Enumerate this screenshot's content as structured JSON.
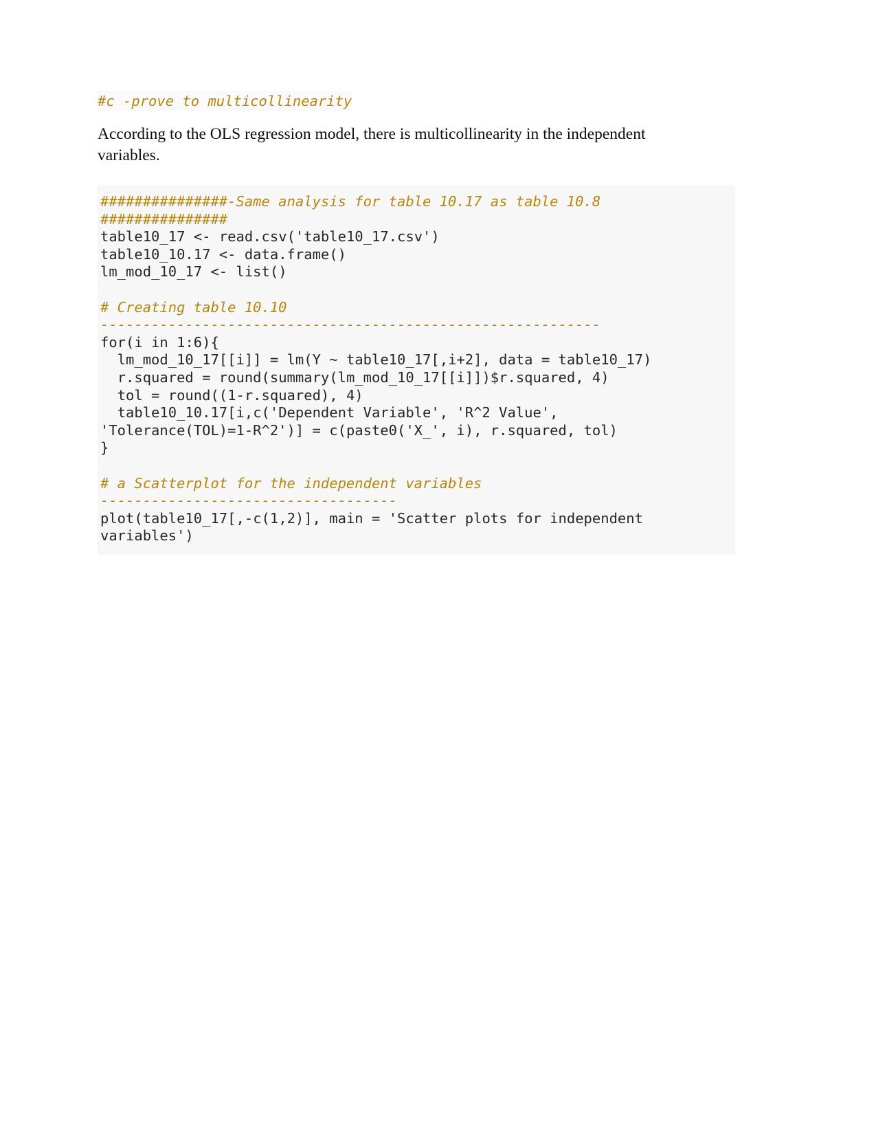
{
  "document": {
    "heading_comment": "#c -prove to multicollinearity",
    "paragraph": "According to the OLS regression model, there is multicollinearity in the independent variables."
  },
  "code_block": {
    "language": "R",
    "background_color": "#f7f7f7",
    "colors": {
      "comment": "#b8860b",
      "function": "#1a4f9c",
      "string": "#4e9a06",
      "number": "#2200cc",
      "operator": "#e08000",
      "argument": "#3b78c3",
      "plain": "#262626"
    },
    "lines": [
      {
        "id": "l1",
        "tokens": [
          {
            "t": "###############-Same analysis for table 10.17 as table 10.8",
            "c": "comment"
          }
        ]
      },
      {
        "id": "l2",
        "tokens": [
          {
            "t": "###############",
            "c": "comment"
          }
        ]
      },
      {
        "id": "l3",
        "tokens": [
          {
            "t": "table10",
            "c": "plain"
          },
          {
            "t": "_17",
            "c": "number"
          },
          {
            "t": " <- ",
            "c": "plain"
          },
          {
            "t": "read.csv",
            "c": "function"
          },
          {
            "t": "(",
            "c": "plain"
          },
          {
            "t": "'table10_17.csv'",
            "c": "string"
          },
          {
            "t": ")",
            "c": "plain"
          }
        ]
      },
      {
        "id": "l4",
        "tokens": [
          {
            "t": "table10",
            "c": "plain"
          },
          {
            "t": "_10.17",
            "c": "number"
          },
          {
            "t": " <- ",
            "c": "plain"
          },
          {
            "t": "data.frame",
            "c": "function"
          },
          {
            "t": "()",
            "c": "plain"
          }
        ]
      },
      {
        "id": "l5",
        "tokens": [
          {
            "t": "lm_mod",
            "c": "plain"
          },
          {
            "t": "_10_17",
            "c": "number"
          },
          {
            "t": " <- ",
            "c": "plain"
          },
          {
            "t": "list",
            "c": "function"
          },
          {
            "t": "()",
            "c": "plain"
          }
        ]
      },
      {
        "id": "l6",
        "tokens": []
      },
      {
        "id": "l7",
        "tokens": [
          {
            "t": "# Creating table 10.10",
            "c": "comment"
          }
        ]
      },
      {
        "id": "l8",
        "tokens": [
          {
            "t": "-----------------------------------------------------------",
            "c": "comment"
          }
        ]
      },
      {
        "id": "l9",
        "tokens": [
          {
            "t": "for",
            "c": "function"
          },
          {
            "t": "(i ",
            "c": "plain"
          },
          {
            "t": "in",
            "c": "function"
          },
          {
            "t": " ",
            "c": "plain"
          },
          {
            "t": "1",
            "c": "number"
          },
          {
            "t": ":",
            "c": "operator"
          },
          {
            "t": "6",
            "c": "number"
          },
          {
            "t": "){",
            "c": "plain"
          }
        ]
      },
      {
        "id": "l10",
        "tokens": [
          {
            "t": "  lm_mod",
            "c": "plain"
          },
          {
            "t": "_10_17",
            "c": "number"
          },
          {
            "t": "[[i]] = ",
            "c": "plain"
          },
          {
            "t": "lm",
            "c": "function"
          },
          {
            "t": "(Y ",
            "c": "plain"
          },
          {
            "t": "~",
            "c": "operator"
          },
          {
            "t": " table10",
            "c": "plain"
          },
          {
            "t": "_17",
            "c": "number"
          },
          {
            "t": "[,i",
            "c": "plain"
          },
          {
            "t": "+",
            "c": "operator"
          },
          {
            "t": "2",
            "c": "number"
          },
          {
            "t": "], ",
            "c": "plain"
          },
          {
            "t": "data",
            "c": "argument"
          },
          {
            "t": " = table10",
            "c": "plain"
          },
          {
            "t": "_17",
            "c": "number"
          },
          {
            "t": ")",
            "c": "plain"
          }
        ]
      },
      {
        "id": "l11",
        "tokens": [
          {
            "t": "  r.squared = ",
            "c": "plain"
          },
          {
            "t": "round",
            "c": "function"
          },
          {
            "t": "(",
            "c": "plain"
          },
          {
            "t": "summary",
            "c": "function"
          },
          {
            "t": "(lm_mod",
            "c": "plain"
          },
          {
            "t": "_10_17",
            "c": "number"
          },
          {
            "t": "[[i]])",
            "c": "plain"
          },
          {
            "t": "$",
            "c": "operator"
          },
          {
            "t": "r.squared, ",
            "c": "plain"
          },
          {
            "t": "4",
            "c": "number"
          },
          {
            "t": ")",
            "c": "plain"
          }
        ]
      },
      {
        "id": "l12",
        "tokens": [
          {
            "t": "  tol = ",
            "c": "plain"
          },
          {
            "t": "round",
            "c": "function"
          },
          {
            "t": "((",
            "c": "plain"
          },
          {
            "t": "1",
            "c": "number"
          },
          {
            "t": "-",
            "c": "operator"
          },
          {
            "t": "r.squared), ",
            "c": "plain"
          },
          {
            "t": "4",
            "c": "number"
          },
          {
            "t": ")",
            "c": "plain"
          }
        ]
      },
      {
        "id": "l13",
        "tokens": [
          {
            "t": "  table10",
            "c": "plain"
          },
          {
            "t": "_10.17",
            "c": "number"
          },
          {
            "t": "[i,",
            "c": "plain"
          },
          {
            "t": "c",
            "c": "function"
          },
          {
            "t": "(",
            "c": "plain"
          },
          {
            "t": "'Dependent Variable'",
            "c": "string"
          },
          {
            "t": ", ",
            "c": "plain"
          },
          {
            "t": "'R^2 Value'",
            "c": "string"
          },
          {
            "t": ",\n",
            "c": "plain"
          },
          {
            "t": "'Tolerance(TOL)=1-R^2'",
            "c": "string"
          },
          {
            "t": ")] = ",
            "c": "plain"
          },
          {
            "t": "c",
            "c": "function"
          },
          {
            "t": "(",
            "c": "plain"
          },
          {
            "t": "paste0",
            "c": "function"
          },
          {
            "t": "(",
            "c": "plain"
          },
          {
            "t": "'X_'",
            "c": "string"
          },
          {
            "t": ", i), r.squared, tol)",
            "c": "plain"
          }
        ]
      },
      {
        "id": "l14",
        "tokens": [
          {
            "t": "}",
            "c": "plain"
          }
        ]
      },
      {
        "id": "l15",
        "tokens": []
      },
      {
        "id": "l16",
        "tokens": [
          {
            "t": "# a Scatterplot for the independent variables",
            "c": "comment"
          }
        ]
      },
      {
        "id": "l17",
        "tokens": [
          {
            "t": "-----------------------------------",
            "c": "comment"
          }
        ]
      },
      {
        "id": "l18",
        "tokens": [
          {
            "t": "plot",
            "c": "function"
          },
          {
            "t": "(table10",
            "c": "plain"
          },
          {
            "t": "_17",
            "c": "number"
          },
          {
            "t": "[,",
            "c": "plain"
          },
          {
            "t": "-",
            "c": "operator"
          },
          {
            "t": "c",
            "c": "function"
          },
          {
            "t": "(",
            "c": "plain"
          },
          {
            "t": "1",
            "c": "number"
          },
          {
            "t": ",",
            "c": "plain"
          },
          {
            "t": "2",
            "c": "number"
          },
          {
            "t": ")], ",
            "c": "plain"
          },
          {
            "t": "main",
            "c": "argument"
          },
          {
            "t": " = ",
            "c": "plain"
          },
          {
            "t": "'Scatter plots for independent variables'",
            "c": "string"
          },
          {
            "t": ")",
            "c": "plain"
          }
        ]
      }
    ]
  }
}
